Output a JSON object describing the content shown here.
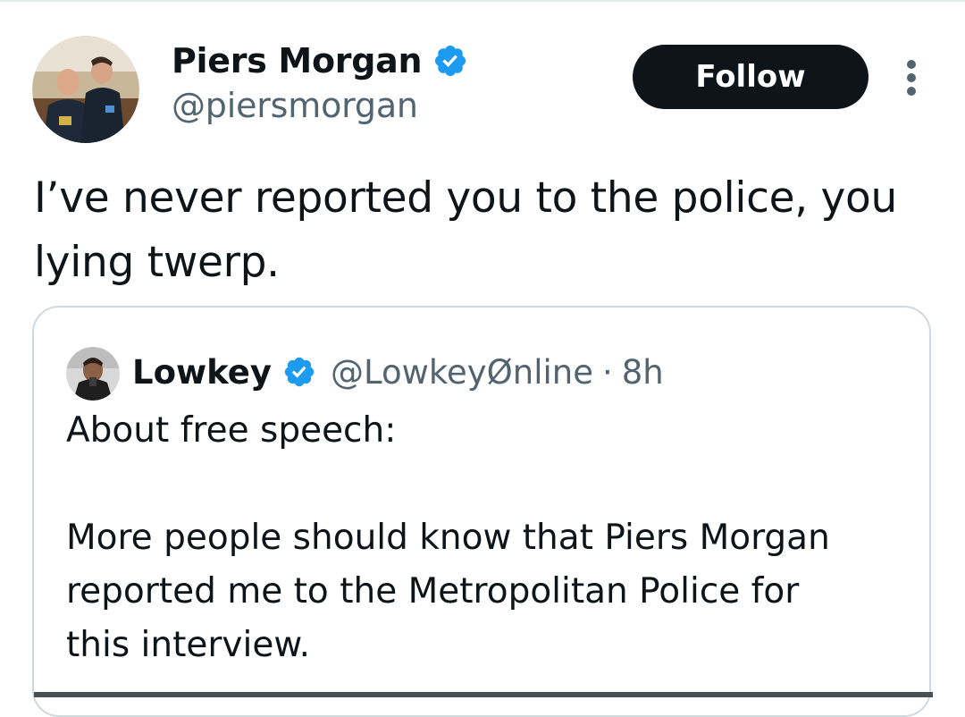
{
  "tweet": {
    "author": {
      "name": "Piers Morgan",
      "handle": "@piersmorgan",
      "verified": true
    },
    "follow_label": "Follow",
    "more_icon": "more-vertical-icon",
    "text": "I’ve never reported you to the police, you\nlying twerp."
  },
  "quote": {
    "author": {
      "name": "Lowkey",
      "handle": "@LowkeyØnline",
      "verified": true
    },
    "separator": "·",
    "time": "8h",
    "text": "About free speech:\n\nMore people should know that Piers Morgan\nreported me to the Metropolitan Police for\nthis interview."
  },
  "colors": {
    "verified_blue": "#1d9bf0",
    "follow_bg": "#0f1419",
    "secondary_text": "#536471",
    "border": "#cfd9de"
  }
}
